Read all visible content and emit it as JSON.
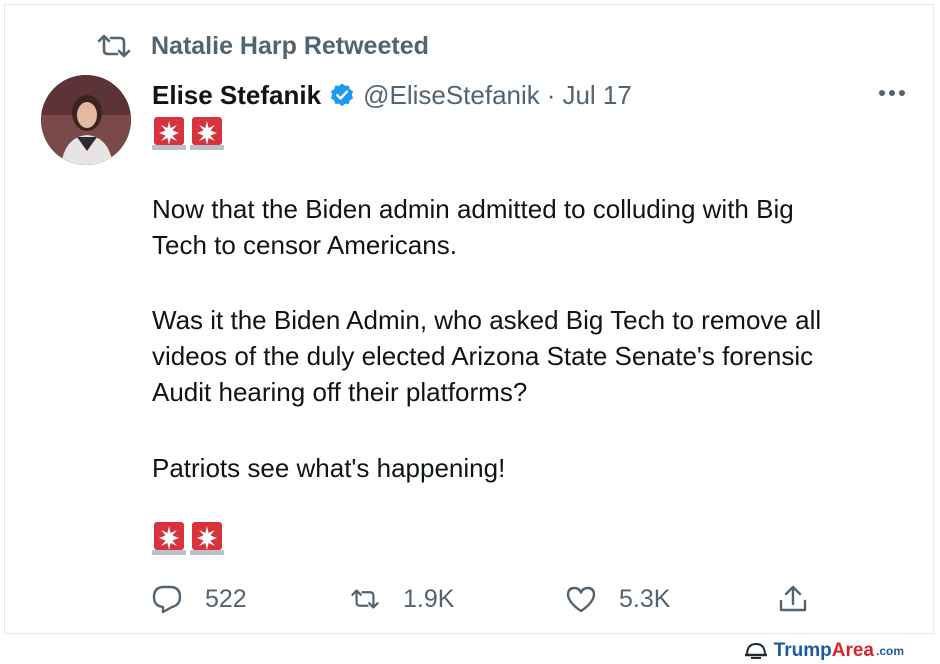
{
  "retweeted_by": "Natalie Harp Retweeted",
  "tweet": {
    "display_name": "Elise Stefanik",
    "handle": "@EliseStefanik",
    "separator": "·",
    "date": "Jul 17",
    "paragraph1_line1": "Now that the Biden admin admitted to colluding with Big",
    "paragraph1_line2": "Tech to censor Americans.",
    "paragraph2_line1": "Was it the Biden Admin, who asked Big Tech to remove all",
    "paragraph2_line2": "videos of the duly elected Arizona State Senate's forensic",
    "paragraph2_line3": "Audit hearing off their platforms?",
    "paragraph3": "Patriots see what's happening!",
    "emoji": "police-car-light"
  },
  "actions": {
    "replies": "522",
    "retweets": "1.9K",
    "likes": "5.3K"
  },
  "watermark": {
    "part1": "Trump",
    "part2": "Area",
    "part3": ".com"
  },
  "colors": {
    "text_primary": "#0f1419",
    "text_secondary": "#536471",
    "verified_blue": "#1d9bf0",
    "siren_red": "#d8323c",
    "watermark_blue": "#1a5aa6",
    "watermark_red": "#d6262b"
  },
  "icons": [
    "retweet-icon",
    "verified-badge-icon",
    "more-options-icon",
    "siren-icon",
    "reply-icon",
    "like-icon",
    "share-icon",
    "helmet-icon"
  ]
}
